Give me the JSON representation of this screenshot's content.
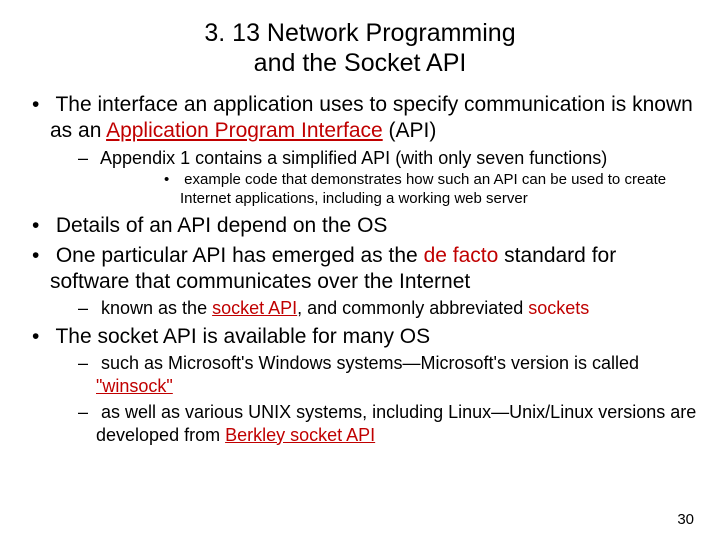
{
  "title_line1": "3. 13  Network Programming",
  "title_line2": "and the Socket API",
  "b1_pre": "The interface an application uses to specify communication is known as an  ",
  "b1_link": "Application Program Interface",
  "b1_post": "  (API)",
  "b1_s1": "Appendix 1 contains a simplified API (with only seven functions)",
  "b1_s1_a": "example code that demonstrates how such an API can be used to create Internet applications, including a working web server",
  "b2": "Details of an API depend on the OS",
  "b3_pre": "One particular API has emerged as the ",
  "b3_red": "de facto",
  "b3_post": " standard for software that communicates over the Internet",
  "b3_s1_pre": "known as the  ",
  "b3_s1_link": "socket API",
  "b3_s1_mid": ", and commonly abbreviated  ",
  "b3_s1_red": "sockets",
  "b4": "The socket API is available for many OS",
  "b4_s1_pre": "such as Microsoft's Windows systems—Microsoft's version is called ",
  "b4_s1_link": "\"winsock\"",
  "b4_s2_pre": "as well as various UNIX systems, including Linux—Unix/Linux versions are developed from ",
  "b4_s2_link": "Berkley socket API",
  "page_number": "30"
}
